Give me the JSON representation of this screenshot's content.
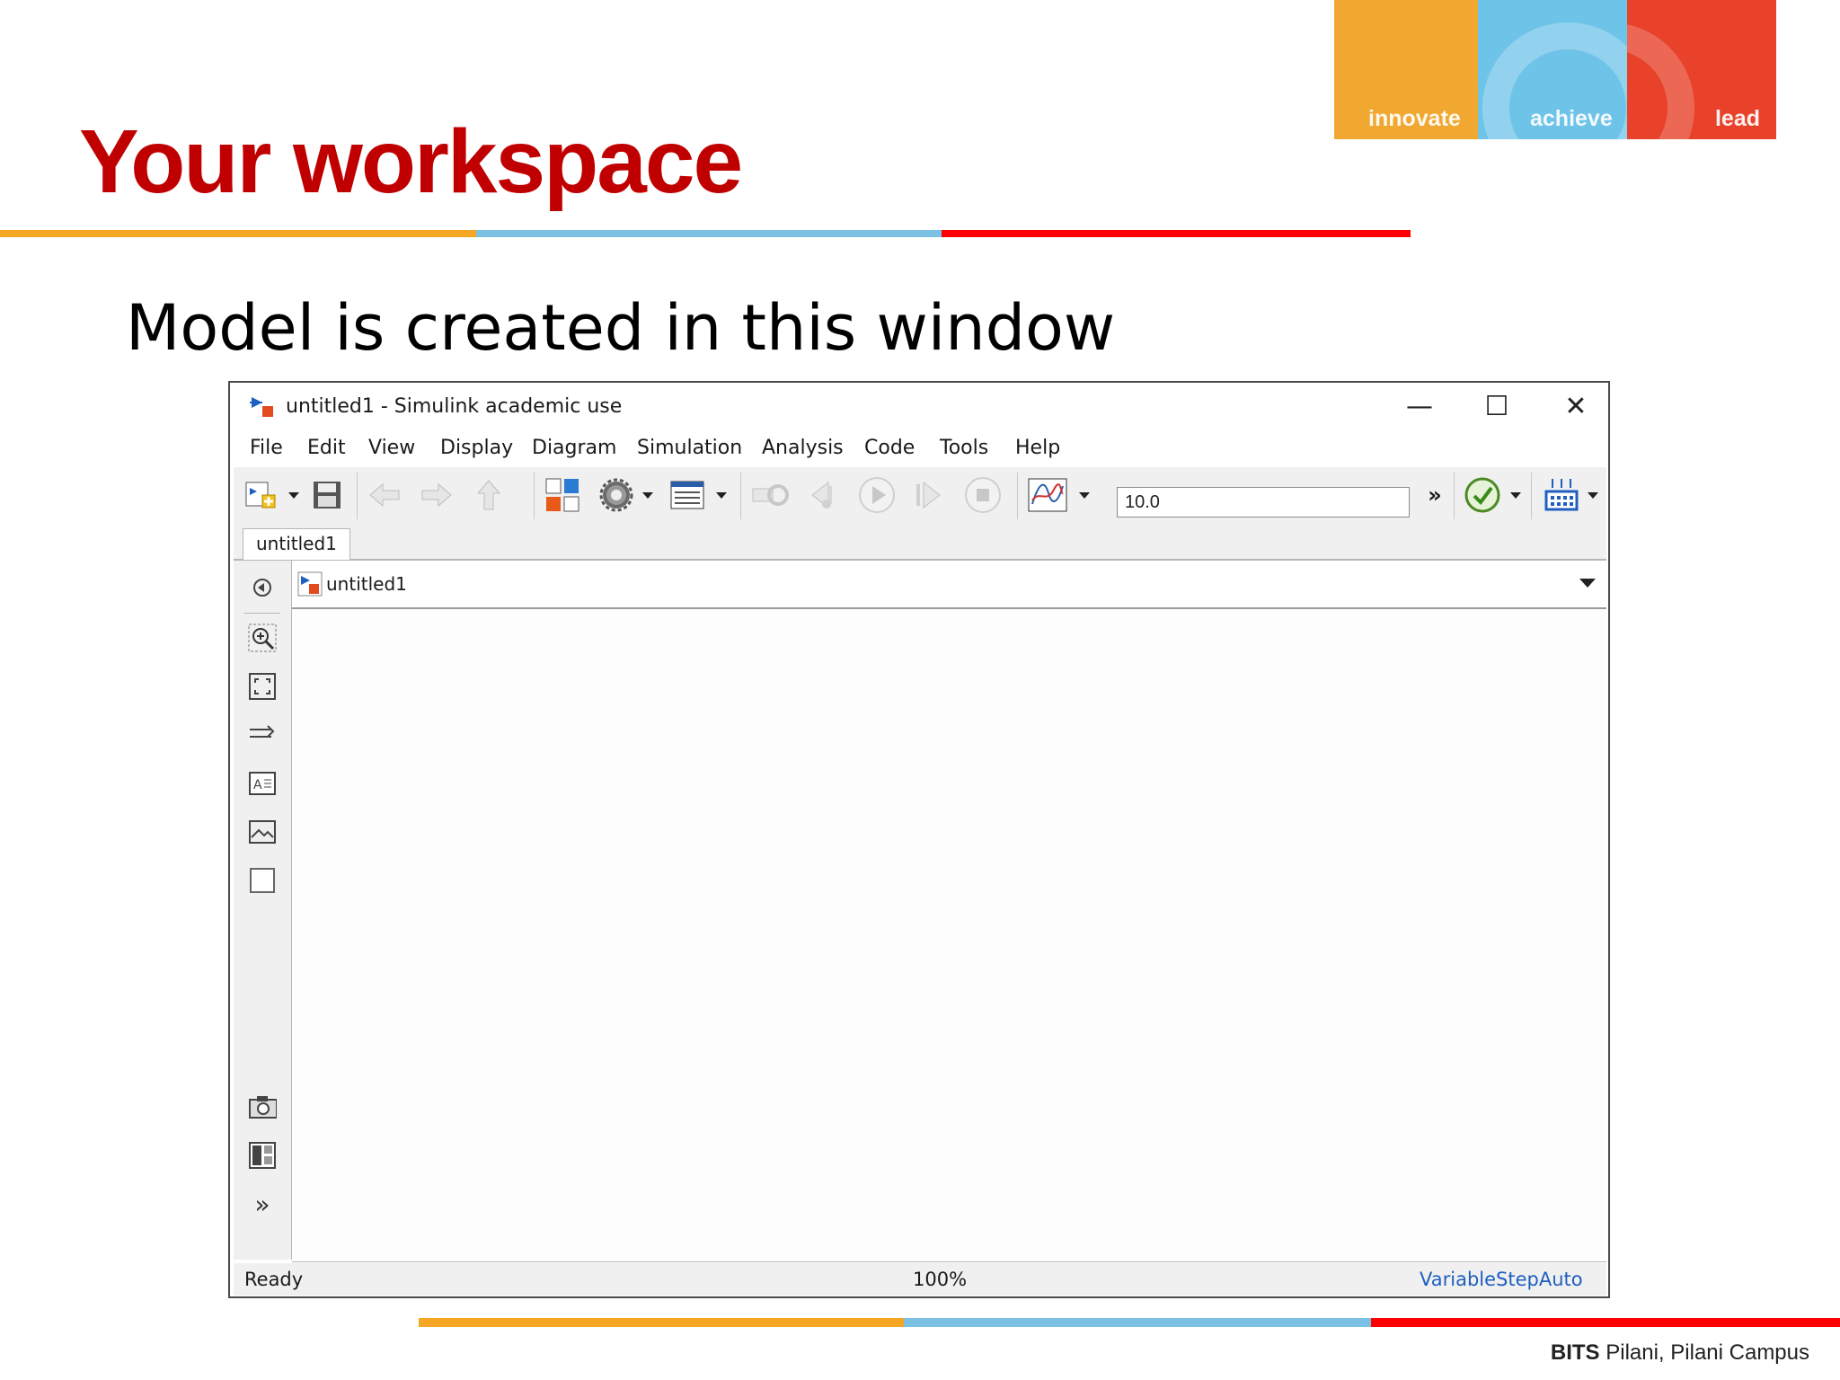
{
  "logo": {
    "segments": [
      {
        "label": "innovate",
        "color": "#f0a830"
      },
      {
        "label": "achieve",
        "color": "#6ec3e8"
      },
      {
        "label": "lead",
        "color": "#e8432a"
      }
    ]
  },
  "slide": {
    "title": "Your workspace",
    "subtitle": "Model is created in this window",
    "stripe_colors": [
      "#f5a623",
      "#7ac1e4",
      "#ff0000"
    ],
    "footer_bold": "BITS",
    "footer_rest": " Pilani, Pilani Campus"
  },
  "window": {
    "title": "untitled1 - Simulink academic use",
    "controls": {
      "minimize": "—",
      "maximize": "☐",
      "close": "✕"
    },
    "menu": [
      "File",
      "Edit",
      "View",
      "Display",
      "Diagram",
      "Simulation",
      "Analysis",
      "Code",
      "Tools",
      "Help"
    ],
    "toolbar": {
      "icons": [
        "new-model-icon",
        "save-icon",
        "back-icon",
        "forward-icon",
        "up-icon",
        "library-browser-icon",
        "model-config-icon",
        "model-explorer-icon",
        "step-back-icon",
        "run-icon",
        "step-forward-icon",
        "stop-icon",
        "scope-icon",
        "check-icon",
        "build-icon"
      ],
      "stop_time": "10.0",
      "overflow": "»"
    },
    "tab": "untitled1",
    "address": "untitled1",
    "status": {
      "left": "Ready",
      "zoom": "100%",
      "solver": "VariableStepAuto"
    },
    "accent_color": "#1f5fbf"
  }
}
